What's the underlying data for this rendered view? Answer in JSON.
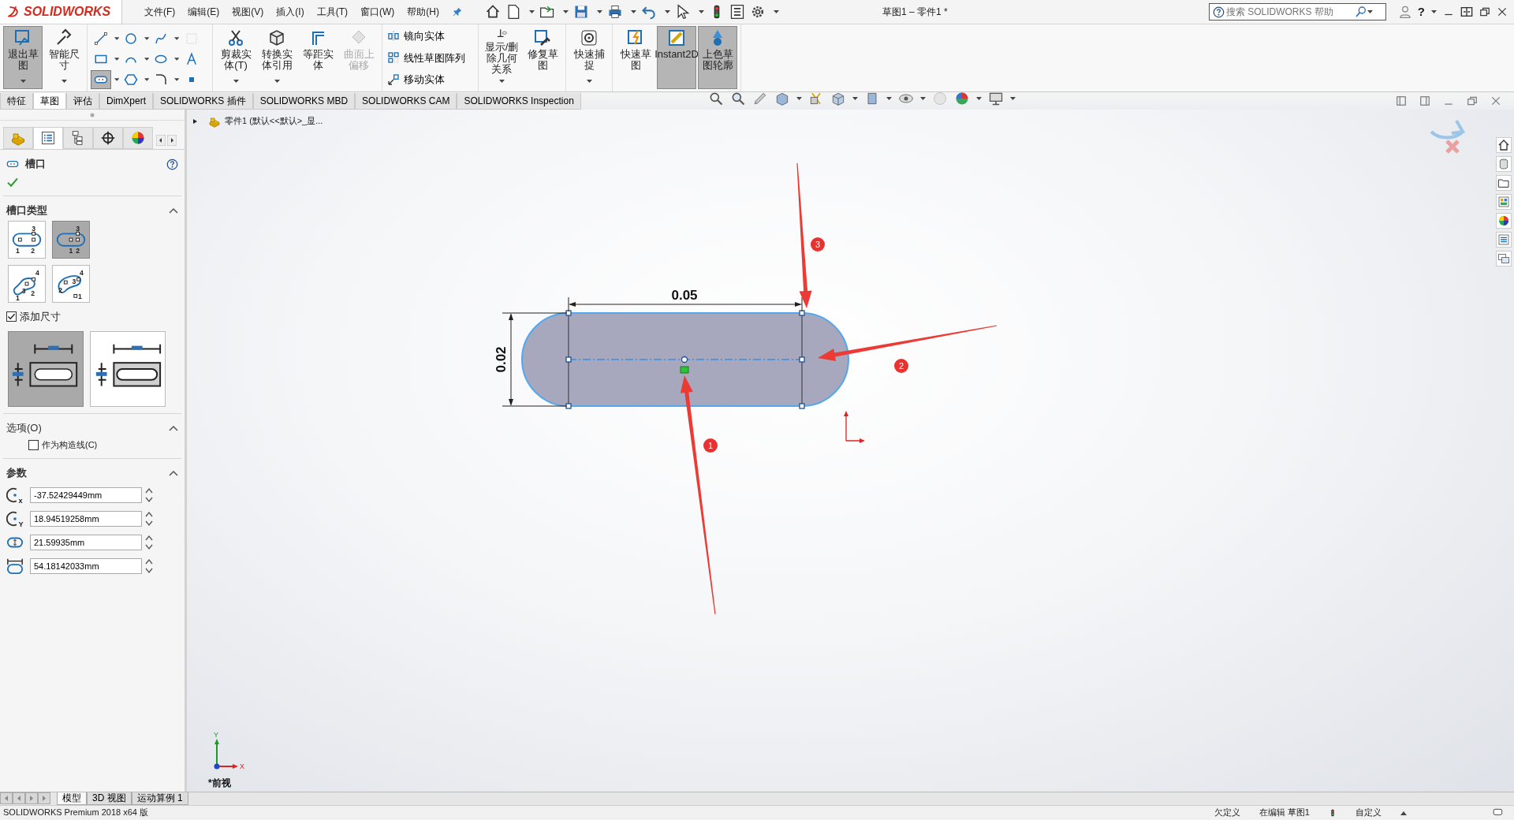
{
  "app": {
    "logo": "SOLIDWORKS",
    "menus": [
      "文件(F)",
      "编辑(E)",
      "视图(V)",
      "插入(I)",
      "工具(T)",
      "窗口(W)",
      "帮助(H)"
    ],
    "title": "草图1 – 零件1 *",
    "search": {
      "placeholder": "搜索 SOLIDWORKS 帮助"
    },
    "help_label": "?"
  },
  "ribbon_groups": [
    {
      "kind": "buttons",
      "items": [
        {
          "label": "退出草图",
          "selected": true,
          "disabled": false,
          "dropdown": true
        },
        {
          "label": "智能尺寸",
          "selected": false,
          "disabled": false,
          "dropdown": true
        }
      ]
    },
    {
      "kind": "tool_grid",
      "tools": [
        {
          "selected": false
        },
        {
          "selected": false
        },
        {
          "selected": false
        },
        {
          "selected": false
        },
        {
          "selected": false
        },
        {
          "selected": false
        },
        {
          "selected": false
        },
        {
          "selected": false
        },
        {
          "selected": true
        },
        {
          "selected": false
        },
        {
          "selected": false
        },
        {
          "selected": false
        }
      ]
    },
    {
      "kind": "buttons",
      "items": [
        {
          "label": "剪裁实体(T)",
          "selected": false,
          "disabled": false,
          "dropdown": true
        },
        {
          "label": "转换实体引用",
          "selected": false,
          "disabled": false,
          "dropdown": true
        },
        {
          "label": "等距实体",
          "selected": false,
          "disabled": false,
          "dropdown": false
        },
        {
          "label": "曲面上偏移",
          "selected": false,
          "disabled": true,
          "dropdown": false
        }
      ]
    },
    {
      "kind": "rows",
      "items": [
        {
          "label": "镜向实体"
        },
        {
          "label": "线性草图阵列"
        },
        {
          "label": "移动实体"
        }
      ]
    },
    {
      "kind": "buttons",
      "items": [
        {
          "label": "显示/删除几何关系",
          "selected": false,
          "disabled": false,
          "dropdown": true
        },
        {
          "label": "修复草图",
          "selected": false,
          "disabled": false,
          "dropdown": false
        }
      ]
    },
    {
      "kind": "buttons",
      "items": [
        {
          "label": "快速捕捉",
          "selected": false,
          "disabled": false,
          "dropdown": true
        }
      ]
    },
    {
      "kind": "buttons",
      "items": [
        {
          "label": "快速草图",
          "selected": false,
          "disabled": false,
          "dropdown": false
        },
        {
          "label": "Instant2D",
          "selected": true,
          "disabled": false,
          "dropdown": false
        },
        {
          "label": "上色草图轮廓",
          "selected": true,
          "disabled": false,
          "dropdown": false
        }
      ]
    }
  ],
  "command_tabs": [
    {
      "label": "特征",
      "selected": false
    },
    {
      "label": "草图",
      "selected": true
    },
    {
      "label": "评估",
      "selected": false
    },
    {
      "label": "DimXpert",
      "selected": false
    },
    {
      "label": "SOLIDWORKS 插件",
      "selected": false
    },
    {
      "label": "SOLIDWORKS MBD",
      "selected": false
    },
    {
      "label": "SOLIDWORKS CAM",
      "selected": false
    },
    {
      "label": "SOLIDWORKS Inspection",
      "selected": false
    }
  ],
  "property_manager": {
    "tabs": [
      {
        "selected": false
      },
      {
        "selected": true
      },
      {
        "selected": false
      },
      {
        "selected": false
      },
      {
        "selected": false
      }
    ],
    "title": "槽口",
    "slot_type": {
      "heading": "槽口类型",
      "options": [
        {
          "selected": false,
          "labels": [
            "3",
            "1",
            "2"
          ]
        },
        {
          "selected": true,
          "labels": [
            "3",
            "1",
            "2"
          ]
        },
        {
          "selected": false,
          "labels": [
            "4",
            "3",
            "2",
            "1"
          ]
        },
        {
          "selected": false,
          "labels": [
            "4",
            "3",
            "2",
            "1"
          ]
        }
      ]
    },
    "add_dimensions": {
      "label": "添加尺寸",
      "checked": true
    },
    "dimension_placement": [
      {
        "selected": true
      },
      {
        "selected": false
      }
    ],
    "options": {
      "heading": "选项(O)",
      "construction": {
        "label": "作为构造线(C)",
        "checked": false
      }
    },
    "parameters": {
      "heading": "参数",
      "fields": [
        {
          "symbol": "x",
          "value": "-37.52429449mm"
        },
        {
          "symbol": "Y",
          "value": "18.94519258mm"
        },
        {
          "value": "21.59935mm"
        },
        {
          "value": "54.18142033mm"
        }
      ]
    }
  },
  "tree": {
    "label": "零件1  (默认<<默认>_显..."
  },
  "canvas": {
    "width_dimension": "0.05",
    "height_dimension": "0.02",
    "callouts": [
      "1",
      "2",
      "3"
    ],
    "triad_labels": [
      "Y",
      "X"
    ],
    "view_label": "*前视"
  },
  "bottom_tabs": [
    {
      "label": "模型",
      "selected": true
    },
    {
      "label": "3D 视图",
      "selected": false
    },
    {
      "label": "运动算例 1",
      "selected": false
    }
  ],
  "status_bar": {
    "product": "SOLIDWORKS Premium 2018 x64 版",
    "items": [
      "欠定义",
      "在编辑 草图1",
      "自定义"
    ]
  }
}
